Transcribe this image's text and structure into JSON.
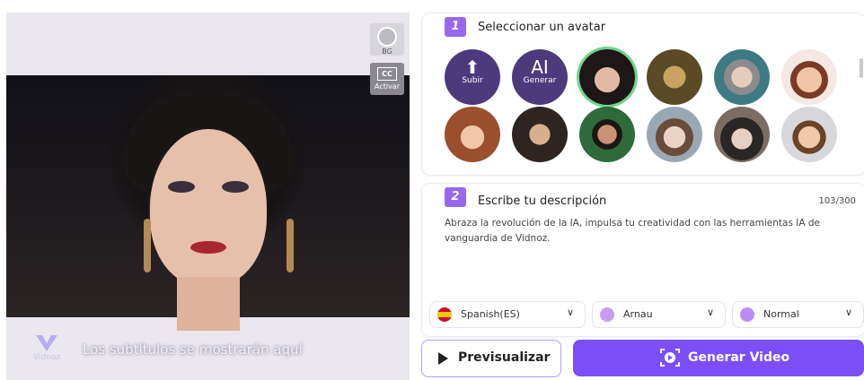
{
  "preview": {
    "bg_label": "BG",
    "cc_icon_text": "CC",
    "cc_label": "Activar",
    "logo_text": "Vidnoz",
    "subtitle_placeholder": "Los subtítulos se mostrarán aquí"
  },
  "step1": {
    "number": "1",
    "title": "Seleccionar un avatar",
    "upload": {
      "icon": "upload-icon",
      "label": "Subir"
    },
    "ai": {
      "big": "AI",
      "label": "Generar"
    },
    "avatars": [
      "woman-short-hair",
      "mona-lisa",
      "einstein",
      "cartoon-man",
      "cartoon-woman",
      "shakespeare",
      "frida",
      "victorian-lady",
      "hat-lady",
      "cartoon-man-2"
    ],
    "selected_avatar": "woman-short-hair"
  },
  "step2": {
    "number": "2",
    "title": "Escribe tu descripción",
    "count": "103/300",
    "text": "Abraza la revolución de la IA, impulsa tu creatividad con las herramientas IA de vanguardia de Vidnoz."
  },
  "selects": {
    "language": "Spanish(ES)",
    "voice": "Arnau",
    "mood": "Normal"
  },
  "buttons": {
    "preview": "Previsualizar",
    "generate": "Generar Video"
  },
  "colors": {
    "accent": "#7b4ef7",
    "badge": "#9966ee",
    "action_avatar": "#4d3a7d",
    "selected_ring": "#6fd58a"
  }
}
